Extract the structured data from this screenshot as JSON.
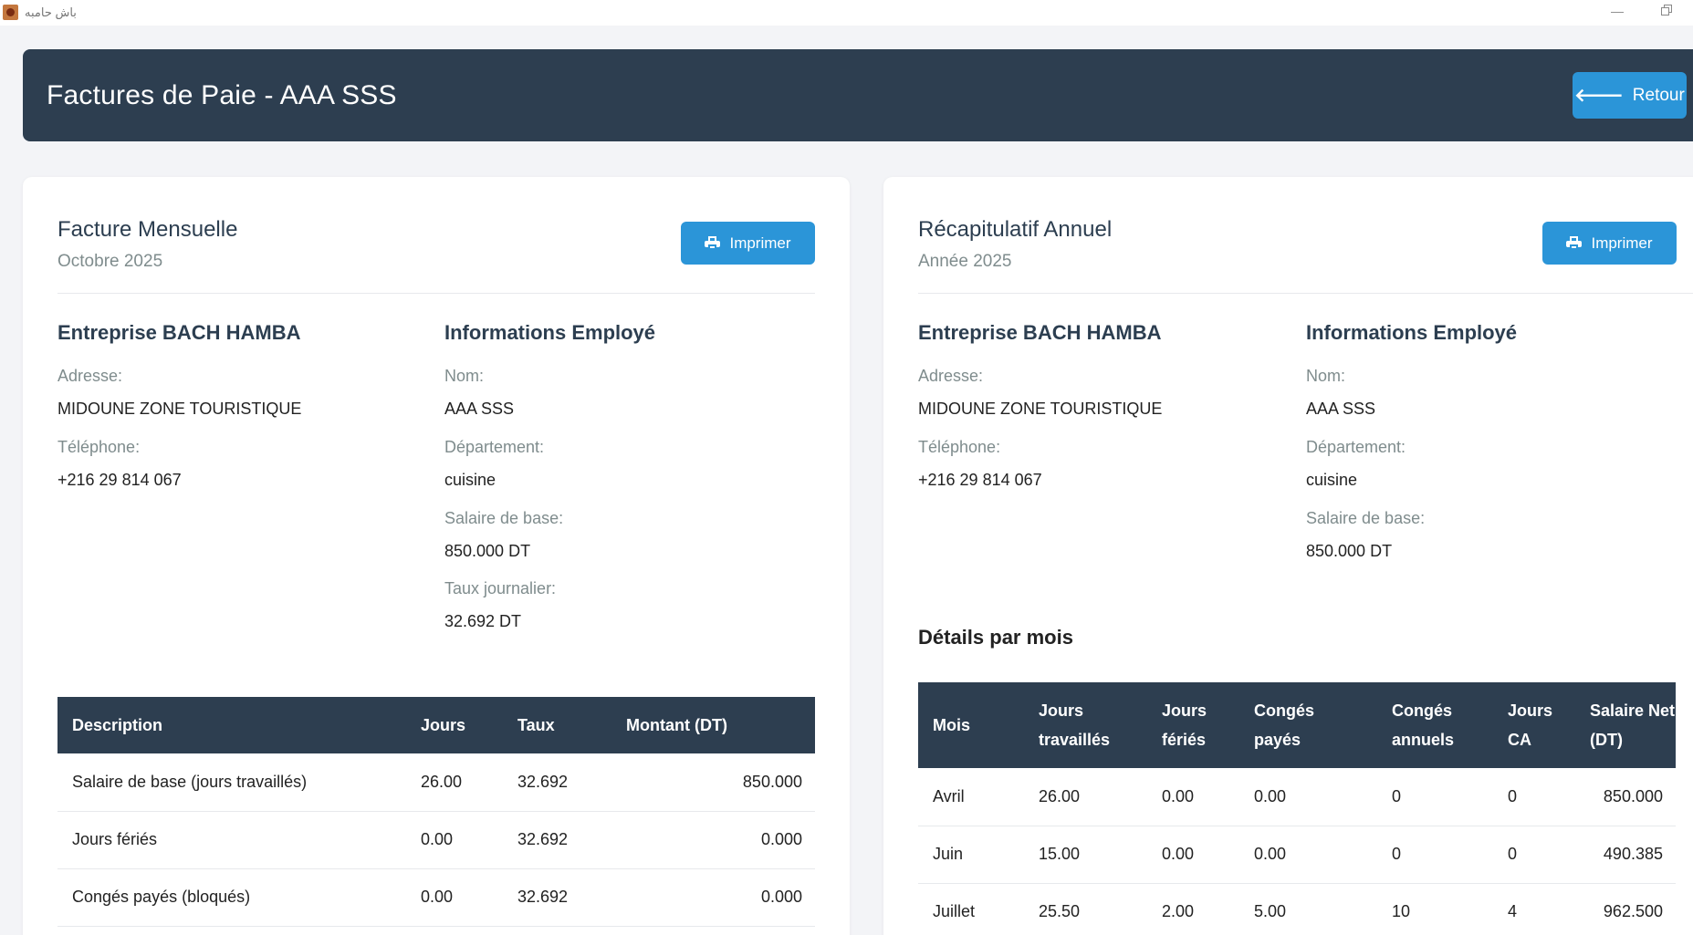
{
  "window": {
    "app_title": "باش حامبه",
    "minimize_glyph": "—"
  },
  "header": {
    "title": "Factures de Paie - AAA SSS",
    "back_label": "Retour"
  },
  "monthly": {
    "title": "Facture Mensuelle",
    "subtitle": "Octobre 2025",
    "print_label": "Imprimer",
    "company": {
      "heading": "Entreprise BACH HAMBA",
      "address_label": "Adresse:",
      "address_value": "MIDOUNE ZONE TOURISTIQUE",
      "phone_label": "Téléphone:",
      "phone_value": "+216 29 814 067"
    },
    "employee": {
      "heading": "Informations Employé",
      "name_label": "Nom:",
      "name_value": "AAA SSS",
      "dept_label": "Département:",
      "dept_value": "cuisine",
      "salary_label": "Salaire de base:",
      "salary_value": "850.000 DT",
      "rate_label": "Taux journalier:",
      "rate_value": "32.692 DT"
    },
    "table": {
      "headers": [
        "Description",
        "Jours",
        "Taux",
        "Montant (DT)"
      ],
      "rows": [
        [
          "Salaire de base (jours travaillés)",
          "26.00",
          "32.692",
          "850.000"
        ],
        [
          "Jours fériés",
          "0.00",
          "32.692",
          "0.000"
        ],
        [
          "Congés payés (bloqués)",
          "0.00",
          "32.692",
          "0.000"
        ]
      ]
    }
  },
  "annual": {
    "title": "Récapitulatif Annuel",
    "subtitle": "Année 2025",
    "print_label": "Imprimer",
    "company": {
      "heading": "Entreprise BACH HAMBA",
      "address_label": "Adresse:",
      "address_value": "MIDOUNE ZONE TOURISTIQUE",
      "phone_label": "Téléphone:",
      "phone_value": "+216 29 814 067"
    },
    "employee": {
      "heading": "Informations Employé",
      "name_label": "Nom:",
      "name_value": "AAA SSS",
      "dept_label": "Département:",
      "dept_value": "cuisine",
      "salary_label": "Salaire de base:",
      "salary_value": "850.000 DT"
    },
    "details_title": "Détails par mois",
    "table": {
      "headers": [
        [
          "Mois"
        ],
        [
          "Jours",
          "travaillés"
        ],
        [
          "Jours",
          "fériés"
        ],
        [
          "Congés",
          "payés"
        ],
        [
          "Congés",
          "annuels"
        ],
        [
          "Jours",
          "CA"
        ],
        [
          "Salaire Net",
          "(DT)"
        ]
      ],
      "rows": [
        [
          "Avril",
          "26.00",
          "0.00",
          "0.00",
          "0",
          "0",
          "850.000"
        ],
        [
          "Juin",
          "15.00",
          "0.00",
          "0.00",
          "0",
          "0",
          "490.385"
        ],
        [
          "Juillet",
          "25.50",
          "2.00",
          "5.00",
          "10",
          "4",
          "962.500"
        ]
      ]
    }
  },
  "colors": {
    "header_bg": "#2d3e50",
    "accent": "#2b95d8",
    "page_bg": "#f3f4f7"
  },
  "icons": {
    "back": "arrow-left-icon",
    "print": "printer-icon"
  }
}
